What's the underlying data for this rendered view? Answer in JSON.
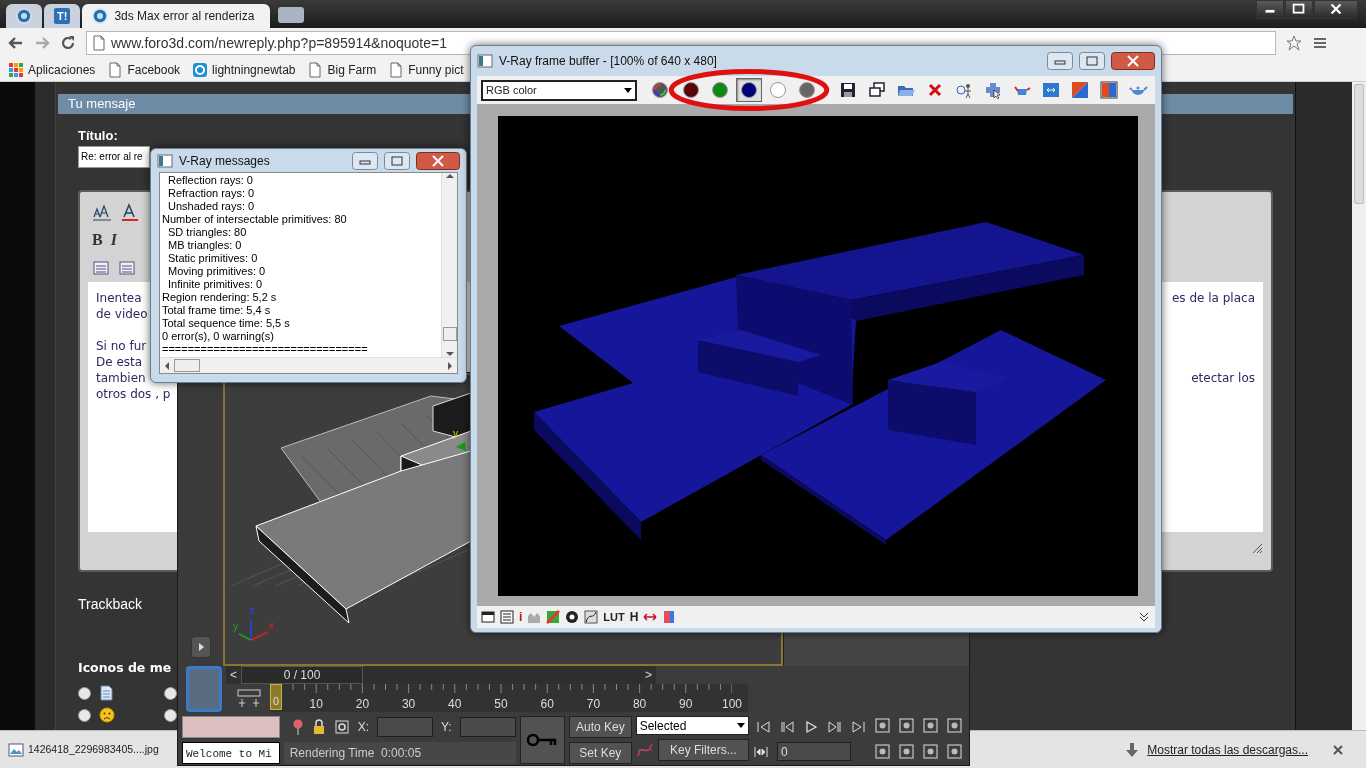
{
  "browser": {
    "tabs": [
      {
        "kind": "globe",
        "selected": false
      },
      {
        "kind": "badge",
        "icon_text": "T!",
        "selected": false
      },
      {
        "kind": "globe",
        "label": "3ds Max error al renderiza",
        "selected": true
      }
    ],
    "url": "www.foro3d.com/newreply.php?p=895914&noquote=1",
    "bookmarks": [
      {
        "kind": "apps",
        "label": "Aplicaciones"
      },
      {
        "kind": "page",
        "label": "Facebook"
      },
      {
        "kind": "ring",
        "label": "lightningnewtab"
      },
      {
        "kind": "page",
        "label": "Big Farm"
      },
      {
        "kind": "page",
        "label": "Funny pict"
      }
    ]
  },
  "forum": {
    "panel_title": "Tu mensaje",
    "title_label": "Título:",
    "title_value": "Re: error al re",
    "format_buttons": [
      "B",
      "I"
    ],
    "paragraphs": [
      [
        {
          "left": "Inentea",
          "right": "es de la placa"
        },
        {
          "left": "de video"
        }
      ],
      [
        {
          "left": "Si no fur"
        },
        {
          "left": "De esta"
        },
        {
          "left": "tambien",
          "right": "etectar los"
        },
        {
          "left": "otros dos , p"
        }
      ]
    ],
    "trackback": "Trackback",
    "icons_heading": "Iconos de me",
    "icon_options": [
      {
        "kind": "document",
        "selected": false
      },
      {
        "kind": "hidden",
        "selected": false
      },
      {
        "kind": "sad",
        "selected": false
      },
      {
        "kind": "hidden",
        "selected": false
      }
    ]
  },
  "downloads": {
    "file": "1426418_2296983405....jpg",
    "show_all": "Mostrar todas las descargas..."
  },
  "max": {
    "axis_labels": [
      "z",
      "x",
      "y"
    ],
    "move_gizmo_label": "y",
    "prev_label": "<",
    "next_label": ">",
    "time_slider": {
      "label": "0 / 100",
      "level": 0,
      "thumb": "0"
    },
    "ticks": [
      "10",
      "20",
      "30",
      "40",
      "50",
      "60",
      "70",
      "80",
      "90",
      "100"
    ],
    "listener": "Welcome to Mi",
    "x_label": "X:",
    "y_label": "Y:",
    "status": "Rendering Time  0:00:05",
    "auto_key": "Auto Key",
    "set_key": "Set Key",
    "key_mode": "Selected",
    "key_filters": "Key Filters...",
    "frame": "0"
  },
  "vray_messages": {
    "title": "V-Ray messages",
    "lines": [
      {
        "children": [
          {
            "text": "Reflection rays: 0"
          },
          {
            "text": "Refraction rays: 0"
          },
          {
            "text": "Unshaded rays: 0"
          }
        ]
      },
      {
        "text": "Number of intersectable primitives: 80",
        "children": [
          {
            "text": "SD triangles: 80"
          },
          {
            "text": "MB triangles: 0"
          },
          {
            "text": "Static primitives: 0"
          },
          {
            "text": "Moving primitives: 0"
          },
          {
            "text": "Infinite primitives: 0"
          }
        ]
      },
      {
        "text": "Region rendering: 5,2 s"
      },
      {
        "text": "Total frame time: 5,4 s"
      },
      {
        "text": "Total sequence time: 5,5 s"
      },
      {
        "text": "0 error(s), 0 warning(s)"
      },
      {
        "text": "================================"
      }
    ]
  },
  "frame_buffer": {
    "title": "V-Ray frame buffer - [100% of 640 x 480]",
    "channel_select": "RGB color",
    "channels": [
      {
        "kind": "rgb",
        "selected": false
      },
      {
        "kind": "red",
        "selected": false
      },
      {
        "kind": "green",
        "selected": false
      },
      {
        "kind": "blue",
        "selected": true
      },
      {
        "kind": "mono",
        "selected": false
      },
      {
        "kind": "alpha",
        "selected": false
      }
    ],
    "info_label": "i",
    "lut_label": "LUT",
    "h_label": "H"
  }
}
